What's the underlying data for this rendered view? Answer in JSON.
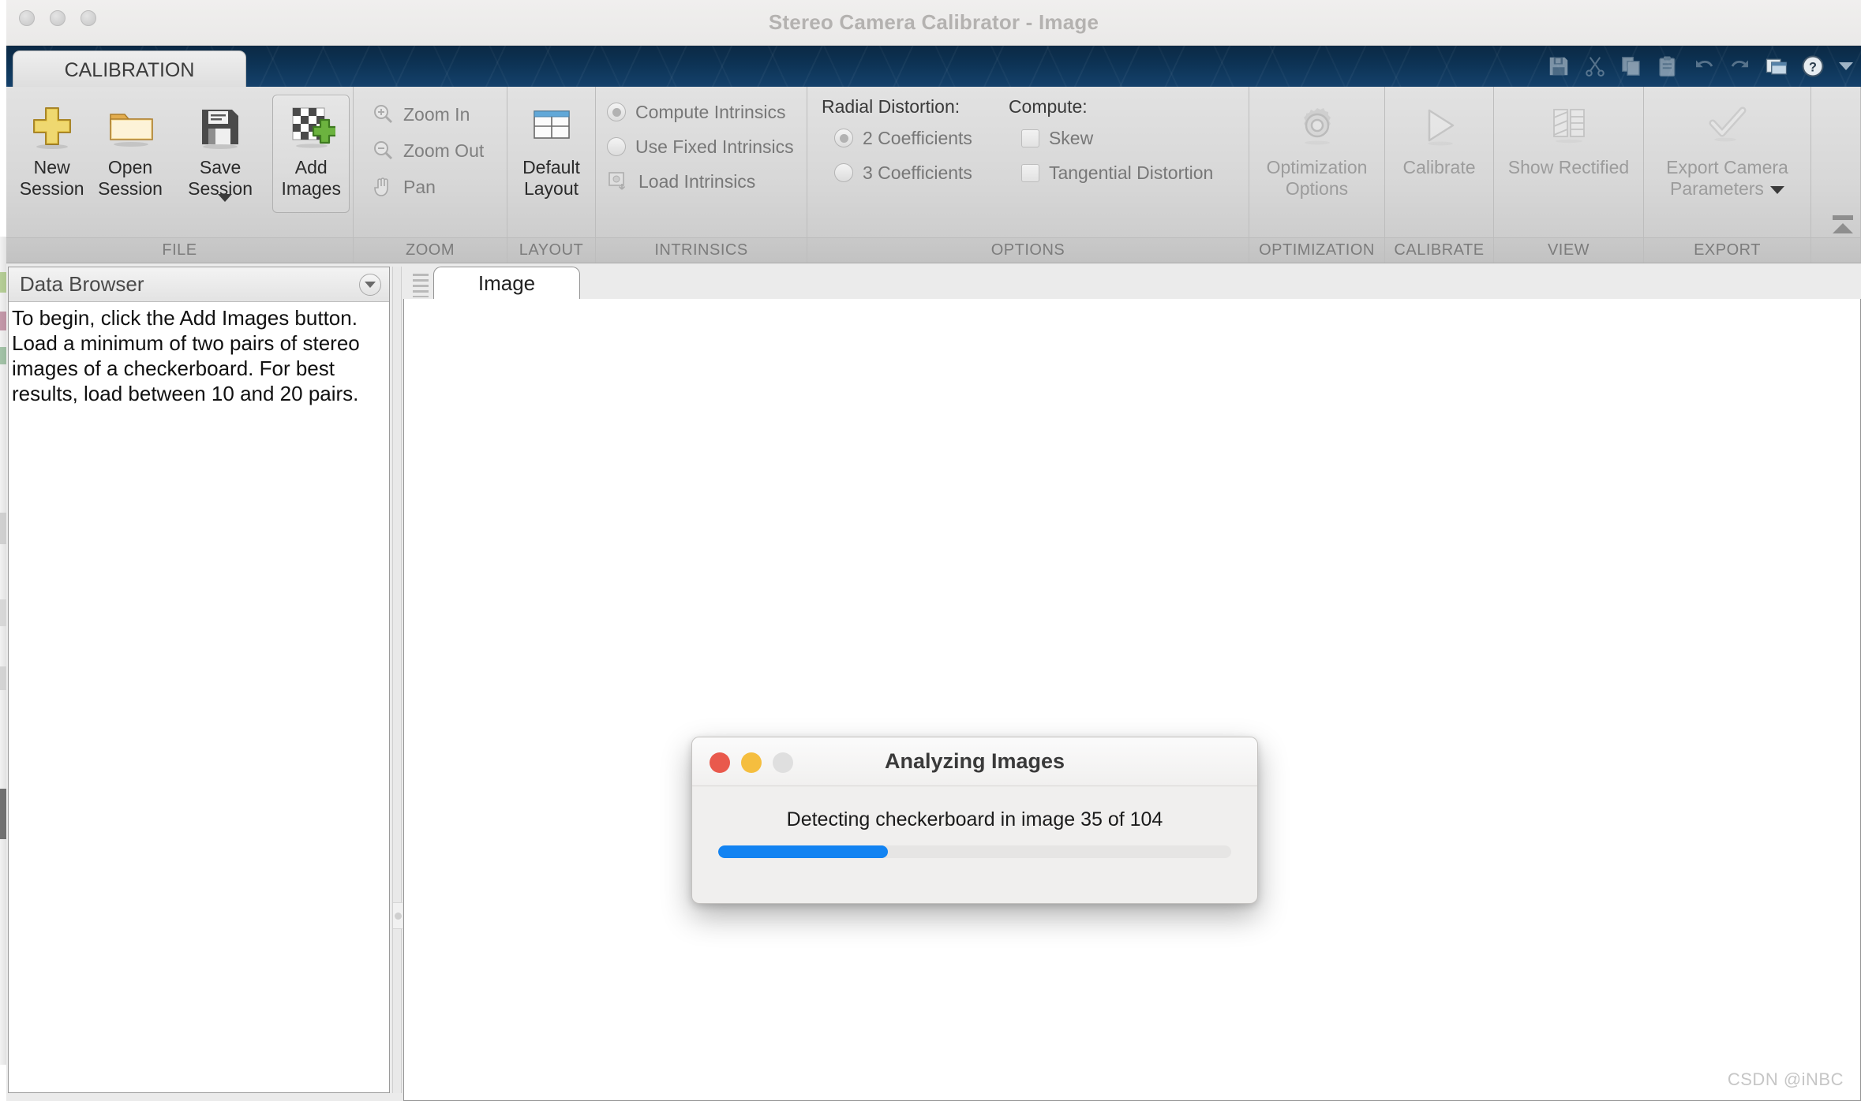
{
  "window": {
    "title": "Stereo Camera Calibrator - Image",
    "traffic_lights": [
      "close",
      "minimize",
      "zoom"
    ]
  },
  "ribbon": {
    "tab": {
      "label": "CALIBRATION"
    },
    "quick_access": [
      {
        "name": "save-icon",
        "label": "Save"
      },
      {
        "name": "cut-icon",
        "label": "Cut"
      },
      {
        "name": "copy-icon",
        "label": "Copy"
      },
      {
        "name": "paste-icon",
        "label": "Paste"
      },
      {
        "name": "undo-icon",
        "label": "Undo"
      },
      {
        "name": "redo-icon",
        "label": "Redo"
      },
      {
        "name": "layout-windows-icon",
        "label": "Layout"
      },
      {
        "name": "help-icon",
        "label": "Help"
      }
    ],
    "groups": [
      {
        "label": "FILE",
        "buttons": [
          {
            "label_line1": "New",
            "label_line2": "Session",
            "icon": "plus-icon",
            "enabled": true,
            "selected": false,
            "has_caret": false
          },
          {
            "label_line1": "Open",
            "label_line2": "Session",
            "icon": "folder-icon",
            "enabled": true,
            "selected": false,
            "has_caret": false
          },
          {
            "label_line1": "Save",
            "label_line2": "Session",
            "icon": "floppy-disk-icon",
            "enabled": true,
            "selected": false,
            "has_caret": true
          },
          {
            "label_line1": "Add",
            "label_line2": "Images",
            "icon": "checkerboard-add-icon",
            "enabled": true,
            "selected": true,
            "has_caret": false
          }
        ]
      },
      {
        "label": "ZOOM",
        "items": [
          {
            "label": "Zoom In",
            "icon": "zoom-in-icon"
          },
          {
            "label": "Zoom Out",
            "icon": "zoom-out-icon"
          },
          {
            "label": "Pan",
            "icon": "pan-hand-icon"
          }
        ]
      },
      {
        "label": "LAYOUT",
        "buttons": [
          {
            "label_line1": "Default",
            "label_line2": "Layout",
            "icon": "grid-layout-icon",
            "enabled": true,
            "selected": false,
            "has_caret": false
          }
        ]
      },
      {
        "label": "INTRINSICS",
        "radios": [
          {
            "label": "Compute Intrinsics",
            "checked": true
          },
          {
            "label": "Use Fixed Intrinsics",
            "checked": false
          }
        ],
        "action": {
          "label": "Load Intrinsics",
          "icon": "load-intrinsics-icon"
        }
      },
      {
        "label": "OPTIONS",
        "radial_distortion": {
          "heading": "Radial Distortion:",
          "radios": [
            {
              "label": "2 Coefficients",
              "checked": true
            },
            {
              "label": "3 Coefficients",
              "checked": false
            }
          ]
        },
        "compute": {
          "heading": "Compute:",
          "checkboxes": [
            {
              "label": "Skew",
              "checked": false
            },
            {
              "label": "Tangential Distortion",
              "checked": false
            }
          ]
        }
      },
      {
        "label": "OPTIMIZATION",
        "buttons": [
          {
            "label_line1": "Optimization",
            "label_line2": "Options",
            "icon": "gear-icon",
            "enabled": false,
            "selected": false,
            "has_caret": false
          }
        ]
      },
      {
        "label": "CALIBRATE",
        "buttons": [
          {
            "label_line1": "Calibrate",
            "label_line2": "",
            "icon": "play-triangle-icon",
            "enabled": false,
            "selected": false,
            "has_caret": false
          }
        ]
      },
      {
        "label": "VIEW",
        "buttons": [
          {
            "label_line1": "Show Rectified",
            "label_line2": "",
            "icon": "rectified-pair-icon",
            "enabled": false,
            "selected": false,
            "has_caret": false
          }
        ]
      },
      {
        "label": "EXPORT",
        "buttons": [
          {
            "label_line1": "Export Camera",
            "label_line2": "Parameters",
            "icon": "checkmark-icon",
            "enabled": false,
            "selected": false,
            "has_caret": true
          }
        ]
      }
    ]
  },
  "data_browser": {
    "title": "Data Browser",
    "collapse_icon": "chevron-down-circle-icon",
    "hint": "To begin, click the Add Images button. Load a minimum of two pairs of stereo images of a checkerboard. For best results, load between 10 and 20 pairs."
  },
  "document_pane": {
    "tabs": [
      {
        "label": "Image",
        "active": true
      }
    ]
  },
  "dialog": {
    "title": "Analyzing Images",
    "message": "Detecting checkerboard in image 35 of 104",
    "progress": {
      "current": 35,
      "total": 104,
      "percent": 33,
      "fill_color": "#1283f2",
      "track_color": "#e6e5e4"
    },
    "traffic_lights": [
      {
        "name": "close",
        "color": "#e9594c"
      },
      {
        "name": "minimize",
        "color": "#f5be3f"
      },
      {
        "name": "zoom",
        "color": "#dfdfdf"
      }
    ]
  },
  "watermark": {
    "text": "CSDN @iNBC"
  },
  "colors": {
    "ribbon_tab_blue": "#0d3355",
    "progress_blue": "#1283f2",
    "window_chrome": "#ececec"
  }
}
